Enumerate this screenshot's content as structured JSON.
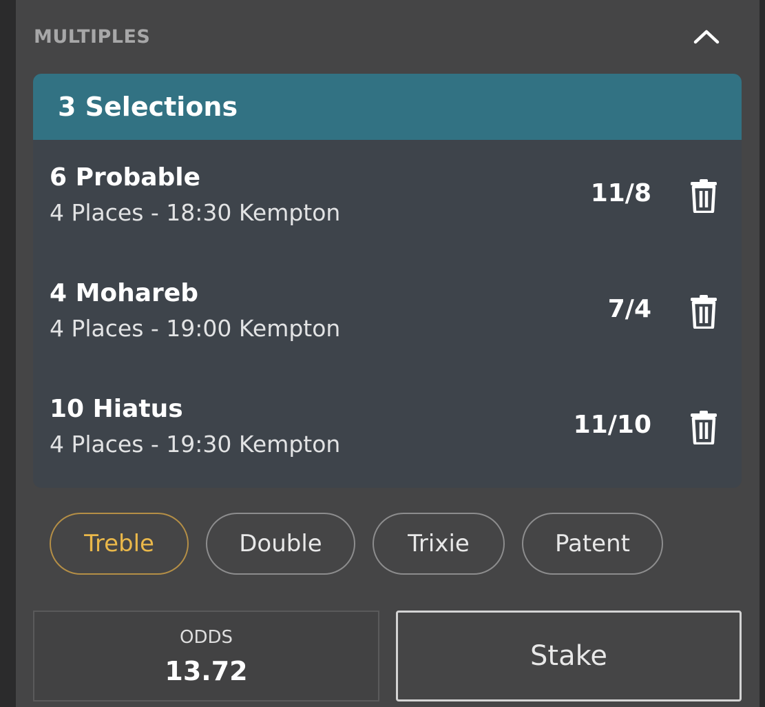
{
  "section": {
    "title": "MULTIPLES"
  },
  "card": {
    "header": "3 Selections",
    "selections": [
      {
        "name": "6 Probable",
        "detail": "4 Places - 18:30 Kempton",
        "odds": "11/8"
      },
      {
        "name": "4 Mohareb",
        "detail": "4 Places - 19:00 Kempton",
        "odds": "7/4"
      },
      {
        "name": "10 Hiatus",
        "detail": "4 Places - 19:30 Kempton",
        "odds": "11/10"
      }
    ]
  },
  "bet_types": [
    {
      "label": "Treble",
      "active": true
    },
    {
      "label": "Double",
      "active": false
    },
    {
      "label": "Trixie",
      "active": false
    },
    {
      "label": "Patent",
      "active": false
    }
  ],
  "summary": {
    "odds_label": "ODDS",
    "odds_value": "13.72",
    "stake_placeholder": "Stake"
  },
  "colors": {
    "header_bg": "#327283",
    "active_pill": "#eab84a",
    "panel_bg": "#454546",
    "card_bg": "#3e444b"
  },
  "icons": {
    "collapse": "chevron-up-icon",
    "remove": "trash-icon"
  }
}
